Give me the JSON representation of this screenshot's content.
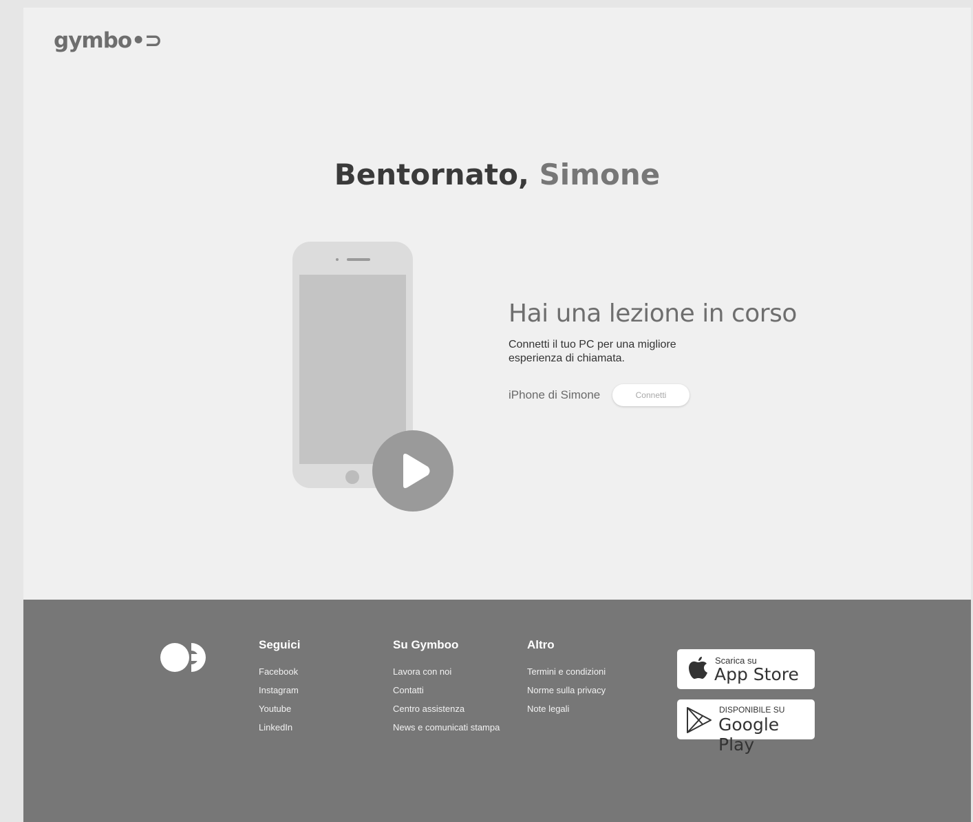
{
  "brand": {
    "logo_text": "gymbo•⊃"
  },
  "hero": {
    "greeting": "Bentornato,",
    "user_name": "Simone"
  },
  "lesson": {
    "title": "Hai una lezione in corso",
    "description": "Connetti il tuo PC per una migliore esperienza di chiamata.",
    "device_name": "iPhone di Simone",
    "connect_label": "Connetti"
  },
  "footer": {
    "columns": [
      {
        "title": "Seguici",
        "links": [
          "Facebook",
          "Instagram",
          "Youtube",
          "LinkedIn"
        ]
      },
      {
        "title": "Su Gymboo",
        "links": [
          "Lavora con noi",
          "Contatti",
          "Centro assistenza",
          "News e comunicati stampa"
        ]
      },
      {
        "title": "Altro",
        "links": [
          "Termini e condizioni",
          "Norme sulla privacy",
          "Note legali"
        ]
      }
    ],
    "app_store": {
      "small": "Scarica su",
      "big": "App Store"
    },
    "google_play": {
      "small": "DISPONIBILE SU",
      "big": "Google Play"
    }
  },
  "colors": {
    "background": "#f0f0f0",
    "footer": "#777777",
    "accent": "#9a9a9a"
  },
  "icons": [
    "gymboo-logo",
    "play-icon",
    "apple-icon",
    "google-play-icon",
    "footer-logo-icon"
  ]
}
